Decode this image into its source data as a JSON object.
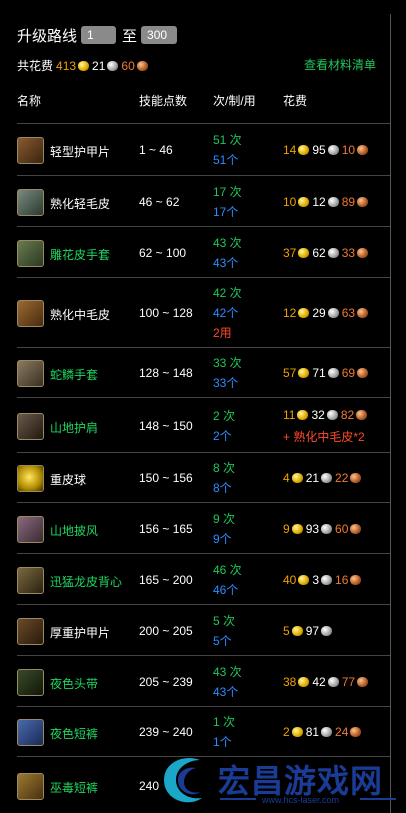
{
  "header": {
    "title": "升级路线",
    "from_value": "1",
    "sep": "至",
    "to_value": "300"
  },
  "total": {
    "label": "共花费",
    "gold": "413",
    "silver": "21",
    "copper": "60"
  },
  "material_link": "查看材料清单",
  "columns": {
    "name": "名称",
    "skill": "技能点数",
    "count": "次/制/用",
    "cost": "花费"
  },
  "rows": [
    {
      "name": "轻型护甲片",
      "name_color": "white",
      "icon": "light-armor-kit-icon",
      "range": "1 ~ 46",
      "times": "51 次",
      "made": "51个",
      "used": "",
      "gold": "14",
      "silver": "95",
      "copper": "10",
      "extra": ""
    },
    {
      "name": "熟化轻毛皮",
      "name_color": "white",
      "icon": "cured-light-hide-icon",
      "range": "46 ~ 62",
      "times": "17 次",
      "made": "17个",
      "used": "",
      "gold": "10",
      "silver": "12",
      "copper": "89",
      "extra": ""
    },
    {
      "name": "雕花皮手套",
      "name_color": "green",
      "icon": "embossed-leather-gloves-icon",
      "range": "62 ~ 100",
      "times": "43 次",
      "made": "43个",
      "used": "",
      "gold": "37",
      "silver": "62",
      "copper": "33",
      "extra": ""
    },
    {
      "name": "熟化中毛皮",
      "name_color": "white",
      "icon": "cured-medium-hide-icon",
      "range": "100 ~ 128",
      "times": "42 次",
      "made": "42个",
      "used": "2用",
      "gold": "12",
      "silver": "29",
      "copper": "63",
      "extra": ""
    },
    {
      "name": "蛇鳞手套",
      "name_color": "green",
      "icon": "murloc-scale-gloves-icon",
      "range": "128 ~ 148",
      "times": "33 次",
      "made": "33个",
      "used": "",
      "gold": "57",
      "silver": "71",
      "copper": "69",
      "extra": ""
    },
    {
      "name": "山地护肩",
      "name_color": "green",
      "icon": "hillman-shoulders-icon",
      "range": "148 ~ 150",
      "times": "2 次",
      "made": "2个",
      "used": "",
      "gold": "11",
      "silver": "32",
      "copper": "82",
      "extra": "+ 熟化中毛皮*2"
    },
    {
      "name": "重皮球",
      "name_color": "white",
      "icon": "heavy-leather-ball-icon",
      "range": "150 ~ 156",
      "times": "8 次",
      "made": "8个",
      "used": "",
      "gold": "4",
      "silver": "21",
      "copper": "22",
      "extra": ""
    },
    {
      "name": "山地披风",
      "name_color": "green",
      "icon": "hillman-cloak-icon",
      "range": "156 ~ 165",
      "times": "9 次",
      "made": "9个",
      "used": "",
      "gold": "9",
      "silver": "93",
      "copper": "60",
      "extra": ""
    },
    {
      "name": "迅猛龙皮背心",
      "name_color": "green",
      "icon": "raptor-hide-harness-icon",
      "range": "165 ~ 200",
      "times": "46 次",
      "made": "46个",
      "used": "",
      "gold": "40",
      "silver": "3",
      "copper": "16",
      "extra": ""
    },
    {
      "name": "厚重护甲片",
      "name_color": "white",
      "icon": "heavy-armor-kit-icon",
      "range": "200 ~ 205",
      "times": "5 次",
      "made": "5个",
      "used": "",
      "gold": "5",
      "silver": "97",
      "copper": "",
      "extra": ""
    },
    {
      "name": "夜色头带",
      "name_color": "green",
      "icon": "nightscape-headband-icon",
      "range": "205 ~ 239",
      "times": "43 次",
      "made": "43个",
      "used": "",
      "gold": "38",
      "silver": "42",
      "copper": "77",
      "extra": ""
    },
    {
      "name": "夜色短裤",
      "name_color": "green",
      "icon": "nightscape-pants-icon",
      "range": "239 ~ 240",
      "times": "1 次",
      "made": "1个",
      "used": "",
      "gold": "2",
      "silver": "81",
      "copper": "24",
      "extra": ""
    },
    {
      "name": "巫毒短裤",
      "name_color": "green",
      "icon": "voodoo-pants-icon",
      "range": "240",
      "times": "",
      "made": "",
      "used": "",
      "gold": "",
      "silver": "",
      "copper": "",
      "extra": ""
    }
  ],
  "watermark": {
    "title": "宏昌游戏网",
    "url": "www.hcs-laser.com"
  },
  "colors": {
    "gold": "#f0a000",
    "copper": "#f07a30",
    "green": "#1ed760",
    "blue": "#2d8cff",
    "red": "#ff4a2a"
  }
}
